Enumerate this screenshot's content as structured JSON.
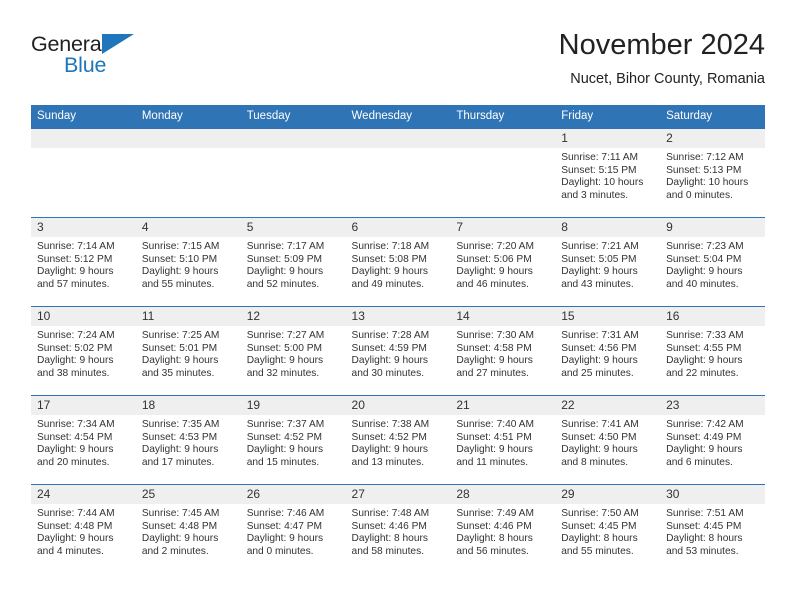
{
  "brand": {
    "name_top": "General",
    "name_bottom": "Blue",
    "accent_color": "#1f76bc"
  },
  "header": {
    "title": "November 2024",
    "subtitle": "Nucet, Bihor County, Romania"
  },
  "theme": {
    "header_blue": "#2f74b5",
    "daynum_band": "#efefef",
    "text": "#333333"
  },
  "calendar": {
    "weekday_headers": [
      "Sunday",
      "Monday",
      "Tuesday",
      "Wednesday",
      "Thursday",
      "Friday",
      "Saturday"
    ],
    "labels": {
      "sunrise": "Sunrise:",
      "sunset": "Sunset:",
      "daylight": "Daylight:"
    },
    "weeks": [
      [
        {
          "day": "",
          "sunrise": "",
          "sunset": "",
          "daylight_line1": "",
          "daylight_line2": ""
        },
        {
          "day": "",
          "sunrise": "",
          "sunset": "",
          "daylight_line1": "",
          "daylight_line2": ""
        },
        {
          "day": "",
          "sunrise": "",
          "sunset": "",
          "daylight_line1": "",
          "daylight_line2": ""
        },
        {
          "day": "",
          "sunrise": "",
          "sunset": "",
          "daylight_line1": "",
          "daylight_line2": ""
        },
        {
          "day": "",
          "sunrise": "",
          "sunset": "",
          "daylight_line1": "",
          "daylight_line2": ""
        },
        {
          "day": "1",
          "sunrise": "Sunrise: 7:11 AM",
          "sunset": "Sunset: 5:15 PM",
          "daylight_line1": "Daylight: 10 hours",
          "daylight_line2": "and 3 minutes."
        },
        {
          "day": "2",
          "sunrise": "Sunrise: 7:12 AM",
          "sunset": "Sunset: 5:13 PM",
          "daylight_line1": "Daylight: 10 hours",
          "daylight_line2": "and 0 minutes."
        }
      ],
      [
        {
          "day": "3",
          "sunrise": "Sunrise: 7:14 AM",
          "sunset": "Sunset: 5:12 PM",
          "daylight_line1": "Daylight: 9 hours",
          "daylight_line2": "and 57 minutes."
        },
        {
          "day": "4",
          "sunrise": "Sunrise: 7:15 AM",
          "sunset": "Sunset: 5:10 PM",
          "daylight_line1": "Daylight: 9 hours",
          "daylight_line2": "and 55 minutes."
        },
        {
          "day": "5",
          "sunrise": "Sunrise: 7:17 AM",
          "sunset": "Sunset: 5:09 PM",
          "daylight_line1": "Daylight: 9 hours",
          "daylight_line2": "and 52 minutes."
        },
        {
          "day": "6",
          "sunrise": "Sunrise: 7:18 AM",
          "sunset": "Sunset: 5:08 PM",
          "daylight_line1": "Daylight: 9 hours",
          "daylight_line2": "and 49 minutes."
        },
        {
          "day": "7",
          "sunrise": "Sunrise: 7:20 AM",
          "sunset": "Sunset: 5:06 PM",
          "daylight_line1": "Daylight: 9 hours",
          "daylight_line2": "and 46 minutes."
        },
        {
          "day": "8",
          "sunrise": "Sunrise: 7:21 AM",
          "sunset": "Sunset: 5:05 PM",
          "daylight_line1": "Daylight: 9 hours",
          "daylight_line2": "and 43 minutes."
        },
        {
          "day": "9",
          "sunrise": "Sunrise: 7:23 AM",
          "sunset": "Sunset: 5:04 PM",
          "daylight_line1": "Daylight: 9 hours",
          "daylight_line2": "and 40 minutes."
        }
      ],
      [
        {
          "day": "10",
          "sunrise": "Sunrise: 7:24 AM",
          "sunset": "Sunset: 5:02 PM",
          "daylight_line1": "Daylight: 9 hours",
          "daylight_line2": "and 38 minutes."
        },
        {
          "day": "11",
          "sunrise": "Sunrise: 7:25 AM",
          "sunset": "Sunset: 5:01 PM",
          "daylight_line1": "Daylight: 9 hours",
          "daylight_line2": "and 35 minutes."
        },
        {
          "day": "12",
          "sunrise": "Sunrise: 7:27 AM",
          "sunset": "Sunset: 5:00 PM",
          "daylight_line1": "Daylight: 9 hours",
          "daylight_line2": "and 32 minutes."
        },
        {
          "day": "13",
          "sunrise": "Sunrise: 7:28 AM",
          "sunset": "Sunset: 4:59 PM",
          "daylight_line1": "Daylight: 9 hours",
          "daylight_line2": "and 30 minutes."
        },
        {
          "day": "14",
          "sunrise": "Sunrise: 7:30 AM",
          "sunset": "Sunset: 4:58 PM",
          "daylight_line1": "Daylight: 9 hours",
          "daylight_line2": "and 27 minutes."
        },
        {
          "day": "15",
          "sunrise": "Sunrise: 7:31 AM",
          "sunset": "Sunset: 4:56 PM",
          "daylight_line1": "Daylight: 9 hours",
          "daylight_line2": "and 25 minutes."
        },
        {
          "day": "16",
          "sunrise": "Sunrise: 7:33 AM",
          "sunset": "Sunset: 4:55 PM",
          "daylight_line1": "Daylight: 9 hours",
          "daylight_line2": "and 22 minutes."
        }
      ],
      [
        {
          "day": "17",
          "sunrise": "Sunrise: 7:34 AM",
          "sunset": "Sunset: 4:54 PM",
          "daylight_line1": "Daylight: 9 hours",
          "daylight_line2": "and 20 minutes."
        },
        {
          "day": "18",
          "sunrise": "Sunrise: 7:35 AM",
          "sunset": "Sunset: 4:53 PM",
          "daylight_line1": "Daylight: 9 hours",
          "daylight_line2": "and 17 minutes."
        },
        {
          "day": "19",
          "sunrise": "Sunrise: 7:37 AM",
          "sunset": "Sunset: 4:52 PM",
          "daylight_line1": "Daylight: 9 hours",
          "daylight_line2": "and 15 minutes."
        },
        {
          "day": "20",
          "sunrise": "Sunrise: 7:38 AM",
          "sunset": "Sunset: 4:52 PM",
          "daylight_line1": "Daylight: 9 hours",
          "daylight_line2": "and 13 minutes."
        },
        {
          "day": "21",
          "sunrise": "Sunrise: 7:40 AM",
          "sunset": "Sunset: 4:51 PM",
          "daylight_line1": "Daylight: 9 hours",
          "daylight_line2": "and 11 minutes."
        },
        {
          "day": "22",
          "sunrise": "Sunrise: 7:41 AM",
          "sunset": "Sunset: 4:50 PM",
          "daylight_line1": "Daylight: 9 hours",
          "daylight_line2": "and 8 minutes."
        },
        {
          "day": "23",
          "sunrise": "Sunrise: 7:42 AM",
          "sunset": "Sunset: 4:49 PM",
          "daylight_line1": "Daylight: 9 hours",
          "daylight_line2": "and 6 minutes."
        }
      ],
      [
        {
          "day": "24",
          "sunrise": "Sunrise: 7:44 AM",
          "sunset": "Sunset: 4:48 PM",
          "daylight_line1": "Daylight: 9 hours",
          "daylight_line2": "and 4 minutes."
        },
        {
          "day": "25",
          "sunrise": "Sunrise: 7:45 AM",
          "sunset": "Sunset: 4:48 PM",
          "daylight_line1": "Daylight: 9 hours",
          "daylight_line2": "and 2 minutes."
        },
        {
          "day": "26",
          "sunrise": "Sunrise: 7:46 AM",
          "sunset": "Sunset: 4:47 PM",
          "daylight_line1": "Daylight: 9 hours",
          "daylight_line2": "and 0 minutes."
        },
        {
          "day": "27",
          "sunrise": "Sunrise: 7:48 AM",
          "sunset": "Sunset: 4:46 PM",
          "daylight_line1": "Daylight: 8 hours",
          "daylight_line2": "and 58 minutes."
        },
        {
          "day": "28",
          "sunrise": "Sunrise: 7:49 AM",
          "sunset": "Sunset: 4:46 PM",
          "daylight_line1": "Daylight: 8 hours",
          "daylight_line2": "and 56 minutes."
        },
        {
          "day": "29",
          "sunrise": "Sunrise: 7:50 AM",
          "sunset": "Sunset: 4:45 PM",
          "daylight_line1": "Daylight: 8 hours",
          "daylight_line2": "and 55 minutes."
        },
        {
          "day": "30",
          "sunrise": "Sunrise: 7:51 AM",
          "sunset": "Sunset: 4:45 PM",
          "daylight_line1": "Daylight: 8 hours",
          "daylight_line2": "and 53 minutes."
        }
      ]
    ]
  }
}
